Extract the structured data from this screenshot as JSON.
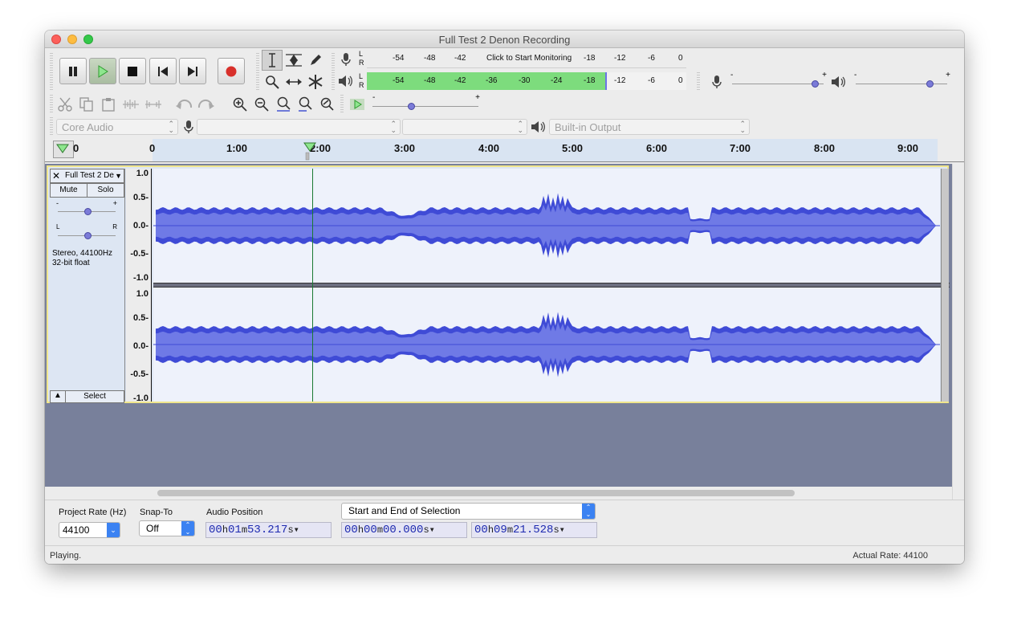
{
  "window": {
    "title": "Full Test 2 Denon Recording"
  },
  "transport": {
    "buttons": [
      "pause",
      "play",
      "stop",
      "skip-to-start",
      "skip-to-end",
      "record"
    ]
  },
  "meters": {
    "record": {
      "ticks": [
        "-54",
        "-48",
        "-42",
        "-18",
        "-12",
        "-6",
        "0"
      ],
      "prompt": "Click to Start Monitoring",
      "channels": [
        "L",
        "R"
      ]
    },
    "playback": {
      "ticks": [
        "-54",
        "-48",
        "-42",
        "-36",
        "-30",
        "-24",
        "-18",
        "-12",
        "-6",
        "0"
      ],
      "channels": [
        "L",
        "R"
      ],
      "level_fraction": 0.75
    }
  },
  "mixer": {
    "record_volume_fraction": 0.9,
    "playback_volume_fraction": 0.8,
    "minus": "-",
    "plus": "+"
  },
  "play_at_speed": {
    "minus": "-",
    "plus": "+",
    "speed_fraction": 0.35
  },
  "devices": {
    "host": "Core Audio",
    "recording_device": "",
    "recording_channels": "",
    "playback_device": "Built-in Output"
  },
  "ruler": {
    "labels": [
      "0",
      "0",
      "1:00",
      "2:00",
      "3:00",
      "4:00",
      "5:00",
      "6:00",
      "7:00",
      "8:00",
      "9:00"
    ]
  },
  "track": {
    "name": "Full Test 2 De",
    "mute_label": "Mute",
    "solo_label": "Solo",
    "gain_minus": "-",
    "gain_plus": "+",
    "pan_left": "L",
    "pan_right": "R",
    "info_line1": "Stereo, 44100Hz",
    "info_line2": "32-bit float",
    "select_label": "Select",
    "amplitude_labels": [
      "1.0",
      "0.5-",
      "0.0-",
      "-0.5-",
      "-1.0"
    ],
    "wave_color": "#3f4bd6",
    "wave_rms_color": "#6f7ae6",
    "playhead_color": "#1a7a32"
  },
  "selection_toolbar": {
    "project_rate_label": "Project Rate (Hz)",
    "project_rate_value": "44100",
    "snap_to_label": "Snap-To",
    "snap_to_value": "Off",
    "audio_position_label": "Audio Position",
    "audio_position": {
      "h": "00",
      "m": "01",
      "s": "53.217"
    },
    "selection_mode": "Start and End of Selection",
    "selection_start": {
      "h": "00",
      "m": "00",
      "s": "00.000"
    },
    "selection_end": {
      "h": "00",
      "m": "09",
      "s": "21.528"
    }
  },
  "status": {
    "left": "Playing.",
    "right": "Actual Rate: 44100"
  }
}
